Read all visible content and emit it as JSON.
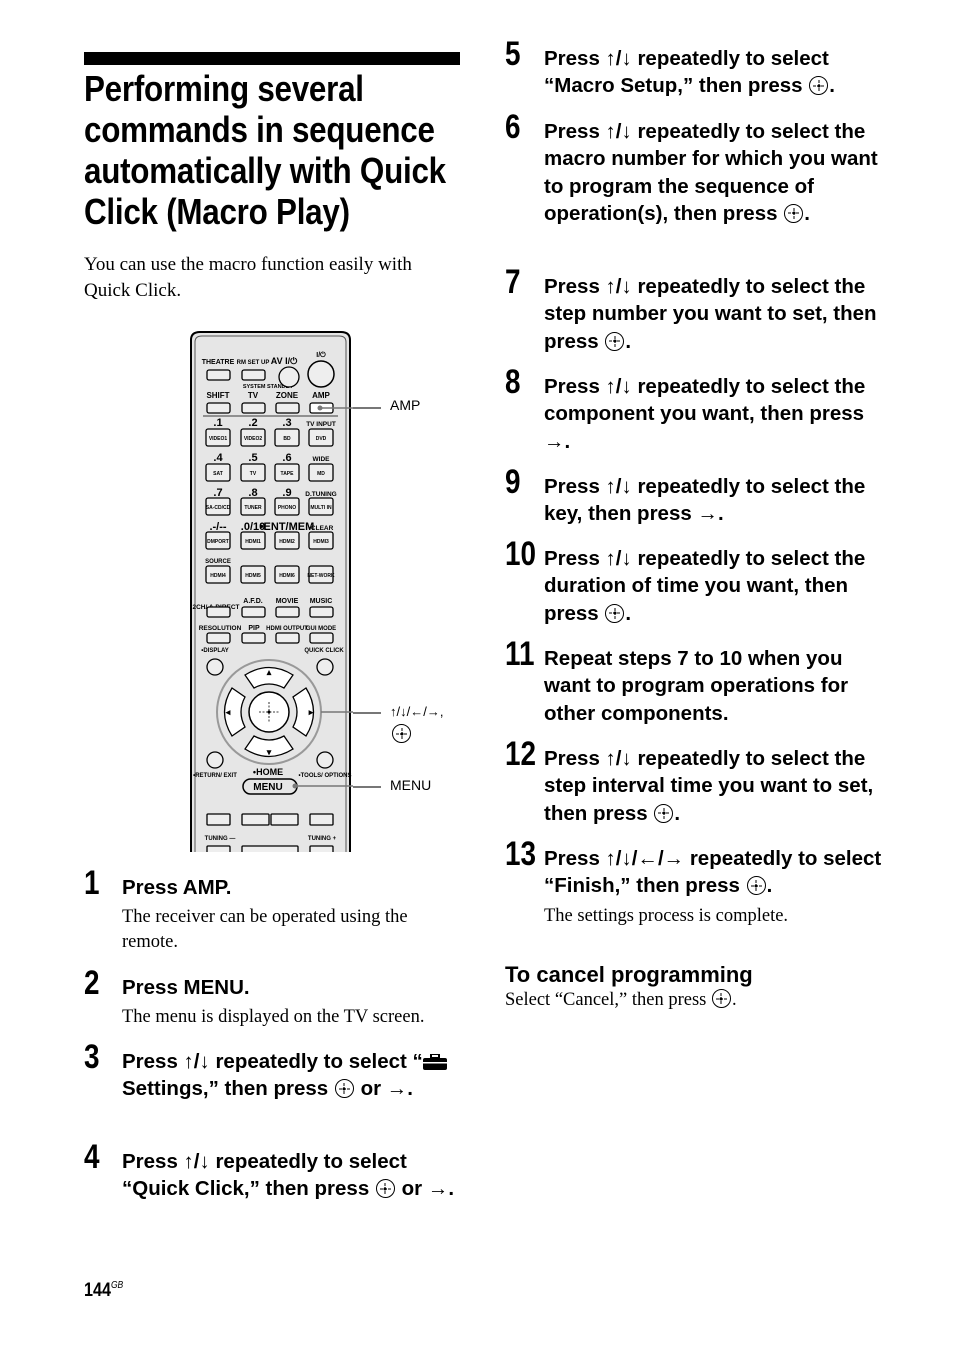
{
  "title": "Performing several commands in sequence automatically with Quick Click (Macro Play)",
  "title_lines": [
    "Performing several",
    "commands in sequence",
    "automatically with Quick",
    "Click (Macro Play)"
  ],
  "intro": "You can use the macro function easily with Quick Click.",
  "remote": {
    "row_labels_top": [
      "THEATRE",
      "RM SET UP",
      "AV I/⏻",
      "I/⏻"
    ],
    "system_standby": "SYSTEM STANDBY",
    "row2_labels": [
      "SHIFT",
      "TV",
      "ZONE",
      "AMP"
    ],
    "num_labels": [
      ".1",
      ".2",
      ".3",
      "TV INPUT",
      ".4",
      ".5",
      ".6",
      "WIDE",
      ".7",
      ".8",
      ".9",
      "D.TUNING",
      ".-/--",
      ".0/10",
      "•ENT/MEM",
      "•CLEAR"
    ],
    "keys": [
      "VIDEO1",
      "VIDEO2",
      "BD",
      "DVD",
      "SAT",
      "TV",
      "TAPE",
      "MD",
      "SA-CD/CD",
      "TUNER",
      "PHONO",
      "MULTI IN",
      "DMPORT",
      "HDMI1",
      "HDMI2",
      "HDMI3",
      "HDMI4",
      "HDMI5",
      "HDMI6",
      "NET-WORK"
    ],
    "source_label": "SOURCE",
    "mode_labels": [
      "2CH/ A.DIRECT",
      "A.F.D.",
      "MOVIE",
      "MUSIC"
    ],
    "mode_labels2": [
      "RESOLUTION",
      "PIP",
      "HDMI OUTPUT",
      "GUI MODE"
    ],
    "display_label": "•DISPLAY",
    "quick_click_label": "QUICK CLICK",
    "return_label": "•RETURN/ EXIT",
    "home_label": "•HOME",
    "menu_label": "MENU",
    "tools_label": "•TOOLS/ OPTIONS",
    "tuning_minus": "TUNING —",
    "tuning_plus": "TUNING +"
  },
  "callouts": {
    "amp": "AMP",
    "arrows": "↑/↓/←/→,",
    "menu": "MENU"
  },
  "steps": [
    {
      "num": "1",
      "text": "Press AMP.",
      "desc": "The receiver can be operated using the remote."
    },
    {
      "num": "2",
      "text": "Press MENU.",
      "desc": "The menu is displayed on the TV screen."
    },
    {
      "num": "3",
      "pre": "Press ↑/↓ repeatedly to select “",
      "mid": "Settings,” then press",
      "post": "or →."
    },
    {
      "num": "4",
      "pre": "Press ↑/↓ repeatedly to select “Quick Click,” then press",
      "post": "or →."
    },
    {
      "num": "5",
      "pre": "Press ↑/↓ repeatedly to select “Macro Setup,” then press",
      "post": "."
    },
    {
      "num": "6",
      "pre": "Press ↑/↓ repeatedly to select the macro number for which you want to program the sequence of operation(s), then press",
      "post": "."
    },
    {
      "num": "7",
      "pre": "Press ↑/↓ repeatedly to select the step number you want to set, then press",
      "post": "."
    },
    {
      "num": "8",
      "text": "Press ↑/↓ repeatedly to select the component you want, then press →."
    },
    {
      "num": "9",
      "text": "Press ↑/↓ repeatedly to select the key, then press →."
    },
    {
      "num": "10",
      "pre": "Press ↑/↓ repeatedly to select the duration of time you want, then press",
      "post": "."
    },
    {
      "num": "11",
      "text": "Repeat steps 7 to 10 when you want to program operations for other components."
    },
    {
      "num": "12",
      "pre": "Press ↑/↓ repeatedly to select the step interval time you want to set, then press",
      "post": "."
    },
    {
      "num": "13",
      "pre": "Press ↑/↓/←/→ repeatedly to select “Finish,” then press",
      "post": ".",
      "desc": "The settings process is complete."
    }
  ],
  "cancel": {
    "heading": "To cancel programming",
    "pre": "Select “Cancel,” then press",
    "post": "."
  },
  "page": {
    "number": "144",
    "suffix": "GB"
  }
}
